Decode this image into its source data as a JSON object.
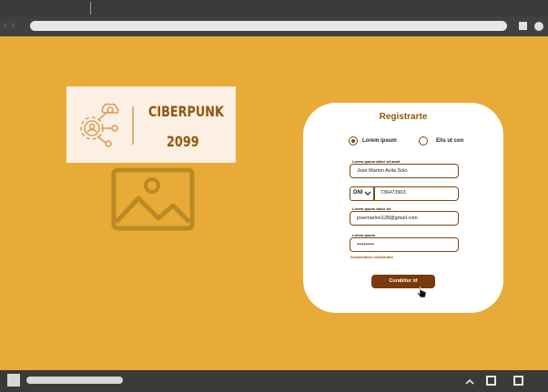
{
  "browser": {
    "nav_arrows": "‹ ›"
  },
  "logo": {
    "title": "CIBERPUNK",
    "year": "2099"
  },
  "form": {
    "title": "Registrarte",
    "radio_options": [
      {
        "label": "Lorem ipsum",
        "selected": true
      },
      {
        "label": "Elis ut con",
        "selected": false
      }
    ],
    "name_label": "Lorem ipsum dolor sit amet",
    "name_value": "Jose Marlon Avila Solo",
    "doc_type": "DNI",
    "doc_number": "736473903",
    "email_label": "Lorem ipsum dolor sit",
    "email_value": "josemarlon128@gmail.com",
    "password_label": "Lorem ipsum",
    "password_value": "••••••••••",
    "help_text": "Suspendisse sollicitudin",
    "submit_label": "Curabitur id"
  },
  "colors": {
    "background": "#E8AB38",
    "accent": "#7A3A0C",
    "brand_text": "#8E5A0D"
  },
  "icons": [
    "chevron-down-icon",
    "gear-network-icon",
    "image-placeholder-icon",
    "hand-pointer-icon"
  ]
}
